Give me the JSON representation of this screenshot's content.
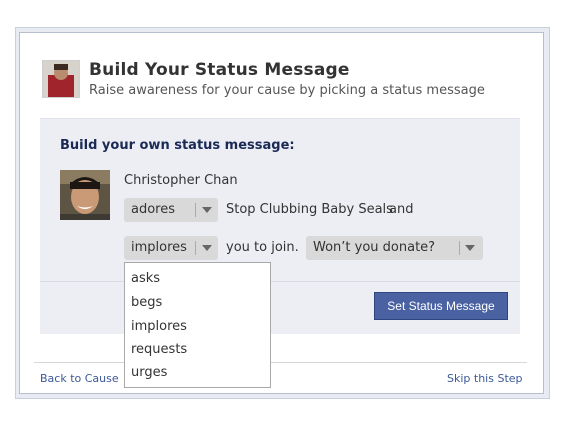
{
  "dialog": {
    "title": "Build Your Status Message",
    "subtitle": "Raise awareness for your cause by picking a status message"
  },
  "builder": {
    "section_label": "Build your own status message:",
    "user_name": "Christopher Chan",
    "verb_select": {
      "selected": "adores"
    },
    "cause_text": "Stop Clubbing Baby Seals",
    "and_text": "and",
    "action_select": {
      "selected": "implores",
      "options": [
        "asks",
        "begs",
        "implores",
        "requests",
        "urges"
      ]
    },
    "join_text": "you to join.",
    "ask_select": {
      "selected": "Won’t you donate?"
    }
  },
  "actions": {
    "set_status_label": "Set Status Message"
  },
  "footer": {
    "back_label": "Back to Cause",
    "skip_label": "Skip this Step"
  },
  "colors": {
    "button_bg": "#4a62a1",
    "link": "#3b5998",
    "panel_bg": "#eceef4",
    "heading": "#1b2a55"
  },
  "icons": {
    "dropdown_caret": "chevron-down-icon"
  }
}
